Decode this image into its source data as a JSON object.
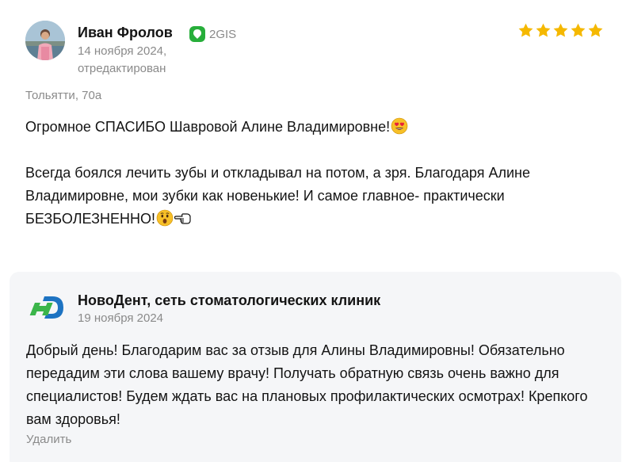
{
  "review": {
    "author_name": "Иван Фролов",
    "source": {
      "label": "2GIS",
      "icon": "2gis-logo-icon",
      "color": "#27ae3a"
    },
    "date": "14 ноября 2024,",
    "edited": "отредактирован",
    "rating": 5,
    "rating_max": 5,
    "star_color": "#f5b800",
    "branch_address": "Тольятти, 70а",
    "paragraph_1": "Огромное СПАСИБО Шавровой Алине Владимировне!",
    "paragraph_1_emoji": "heart-eyes-emoji-icon",
    "paragraph_2": "Всегда боялся лечить зубы и откладывал на потом, а зря. Благодаря Алине Владимировне, мои зубки как новенькие! И самое главное- практически БЕЗБОЛЕЗНЕННО!",
    "paragraph_2_emojis": [
      "astonished-face-emoji-icon",
      "pointing-left-hand-emoji-icon"
    ]
  },
  "reply": {
    "org_name": "НовоДент, сеть стоматологических клиник",
    "org_logo": "novodent-logo-icon",
    "brand_colors": [
      "#1d73c2",
      "#3bb54a"
    ],
    "date": "19 ноября 2024",
    "text": "Добрый день! Благодарим вас за отзыв для Алины Владимировны! Обязательно передадим эти слова вашему врачу! Получать обратную связь очень важно для специалистов! Будем ждать вас на плановых профилактических осмотрах! Крепкого вам здоровья!",
    "delete_label": "Удалить"
  }
}
